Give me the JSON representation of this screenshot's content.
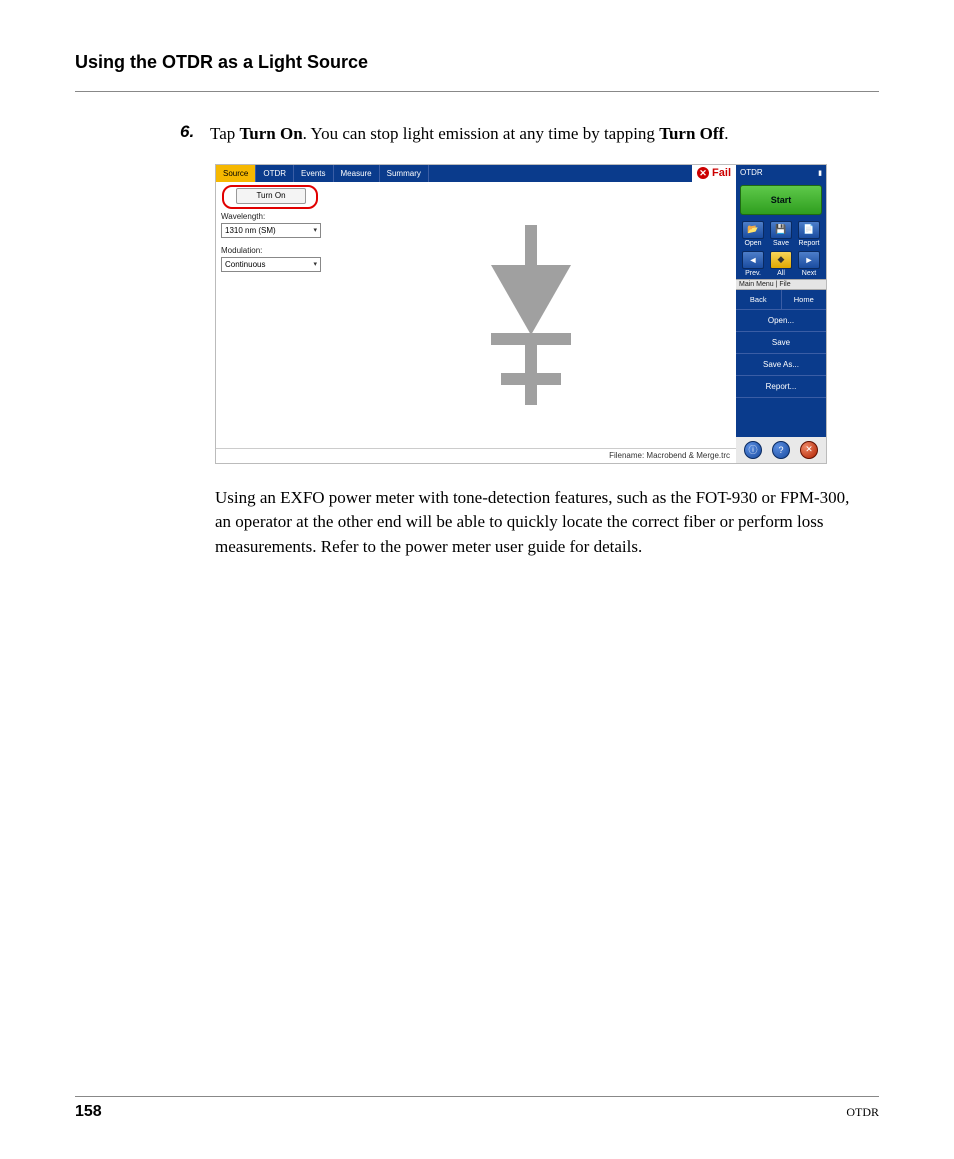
{
  "header": {
    "section_title": "Using the OTDR as a Light Source"
  },
  "step": {
    "number": "6.",
    "text_pre": "Tap ",
    "bold1": "Turn On",
    "text_mid": ". You can stop light emission at any time by tapping ",
    "bold2": "Turn Off",
    "text_post": "."
  },
  "app": {
    "tabs": [
      "Source",
      "OTDR",
      "Events",
      "Measure",
      "Summary"
    ],
    "active_tab_index": 0,
    "status_label": "Fail",
    "left_panel": {
      "turn_on_label": "Turn On",
      "wavelength_label": "Wavelength:",
      "wavelength_value": "1310 nm (SM)",
      "modulation_label": "Modulation:",
      "modulation_value": "Continuous"
    },
    "filename_label": "Filename: Macrobend & Merge.trc",
    "side": {
      "title": "OTDR",
      "start_label": "Start",
      "row1": [
        {
          "label": "Open",
          "icon": "📂"
        },
        {
          "label": "Save",
          "icon": "💾"
        },
        {
          "label": "Report",
          "icon": "📄"
        }
      ],
      "row2": [
        {
          "label": "Prev.",
          "icon": "◄"
        },
        {
          "label": "All",
          "icon": "◆",
          "yellow": true
        },
        {
          "label": "Next",
          "icon": "►"
        }
      ],
      "menu_header": "Main Menu | File",
      "menu_row": [
        "Back",
        "Home"
      ],
      "menu_items": [
        "Open...",
        "Save",
        "Save As...",
        "Report..."
      ],
      "bottom_icons": [
        "ⓘ",
        "?",
        "✕"
      ]
    }
  },
  "body_para": "Using an EXFO power meter with tone-detection features, such as the FOT-930 or FPM-300, an operator at the other end will be able to quickly locate the correct fiber or perform loss measurements. Refer to the power meter user guide for details.",
  "footer": {
    "page_number": "158",
    "doc_label": "OTDR"
  }
}
